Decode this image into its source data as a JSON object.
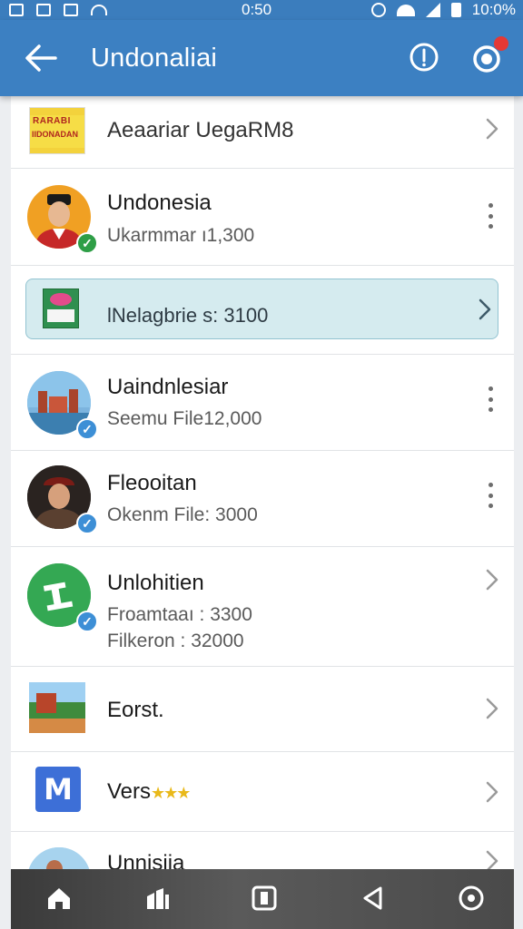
{
  "status_bar": {
    "time": "0:50",
    "battery": "10:0%"
  },
  "app_bar": {
    "title": "Undonaliai"
  },
  "list": [
    {
      "title": "Aeaariar UegaRM8",
      "thumb_text_1": "RARABI",
      "thumb_text_2": "IIDONADAN"
    },
    {
      "title": "Undonesia",
      "sub": "Ukarmmar ı1,300",
      "badge": "green-check"
    },
    {
      "title": "lNelagbrie s: 3100",
      "highlighted": true
    },
    {
      "title": "Uaindnlesiar",
      "sub": "Seemu File12,000",
      "badge": "blue-check"
    },
    {
      "title": "Fleooitan",
      "sub": "Okenm File: 3000",
      "badge": "blue-check"
    },
    {
      "title": "Unlohitien",
      "sub": "Froamtaaı : 3300",
      "sub2": "Filkeron : 32000",
      "badge": "blue-check"
    },
    {
      "title": "Eorst."
    },
    {
      "title": "Vers",
      "rating_stars": "★★★",
      "icon_letter": "M"
    },
    {
      "title": "Unnisiia"
    }
  ],
  "colors": {
    "appbar": "#3c80c2",
    "highlight": "#d5ebef",
    "green_badge": "#2e9e46",
    "blue_badge": "#3d8fd6",
    "notification": "#e53935"
  },
  "nav": {
    "icons": [
      "home-icon",
      "books-icon",
      "square-app-icon",
      "back-triangle-icon",
      "circle-icon"
    ]
  }
}
